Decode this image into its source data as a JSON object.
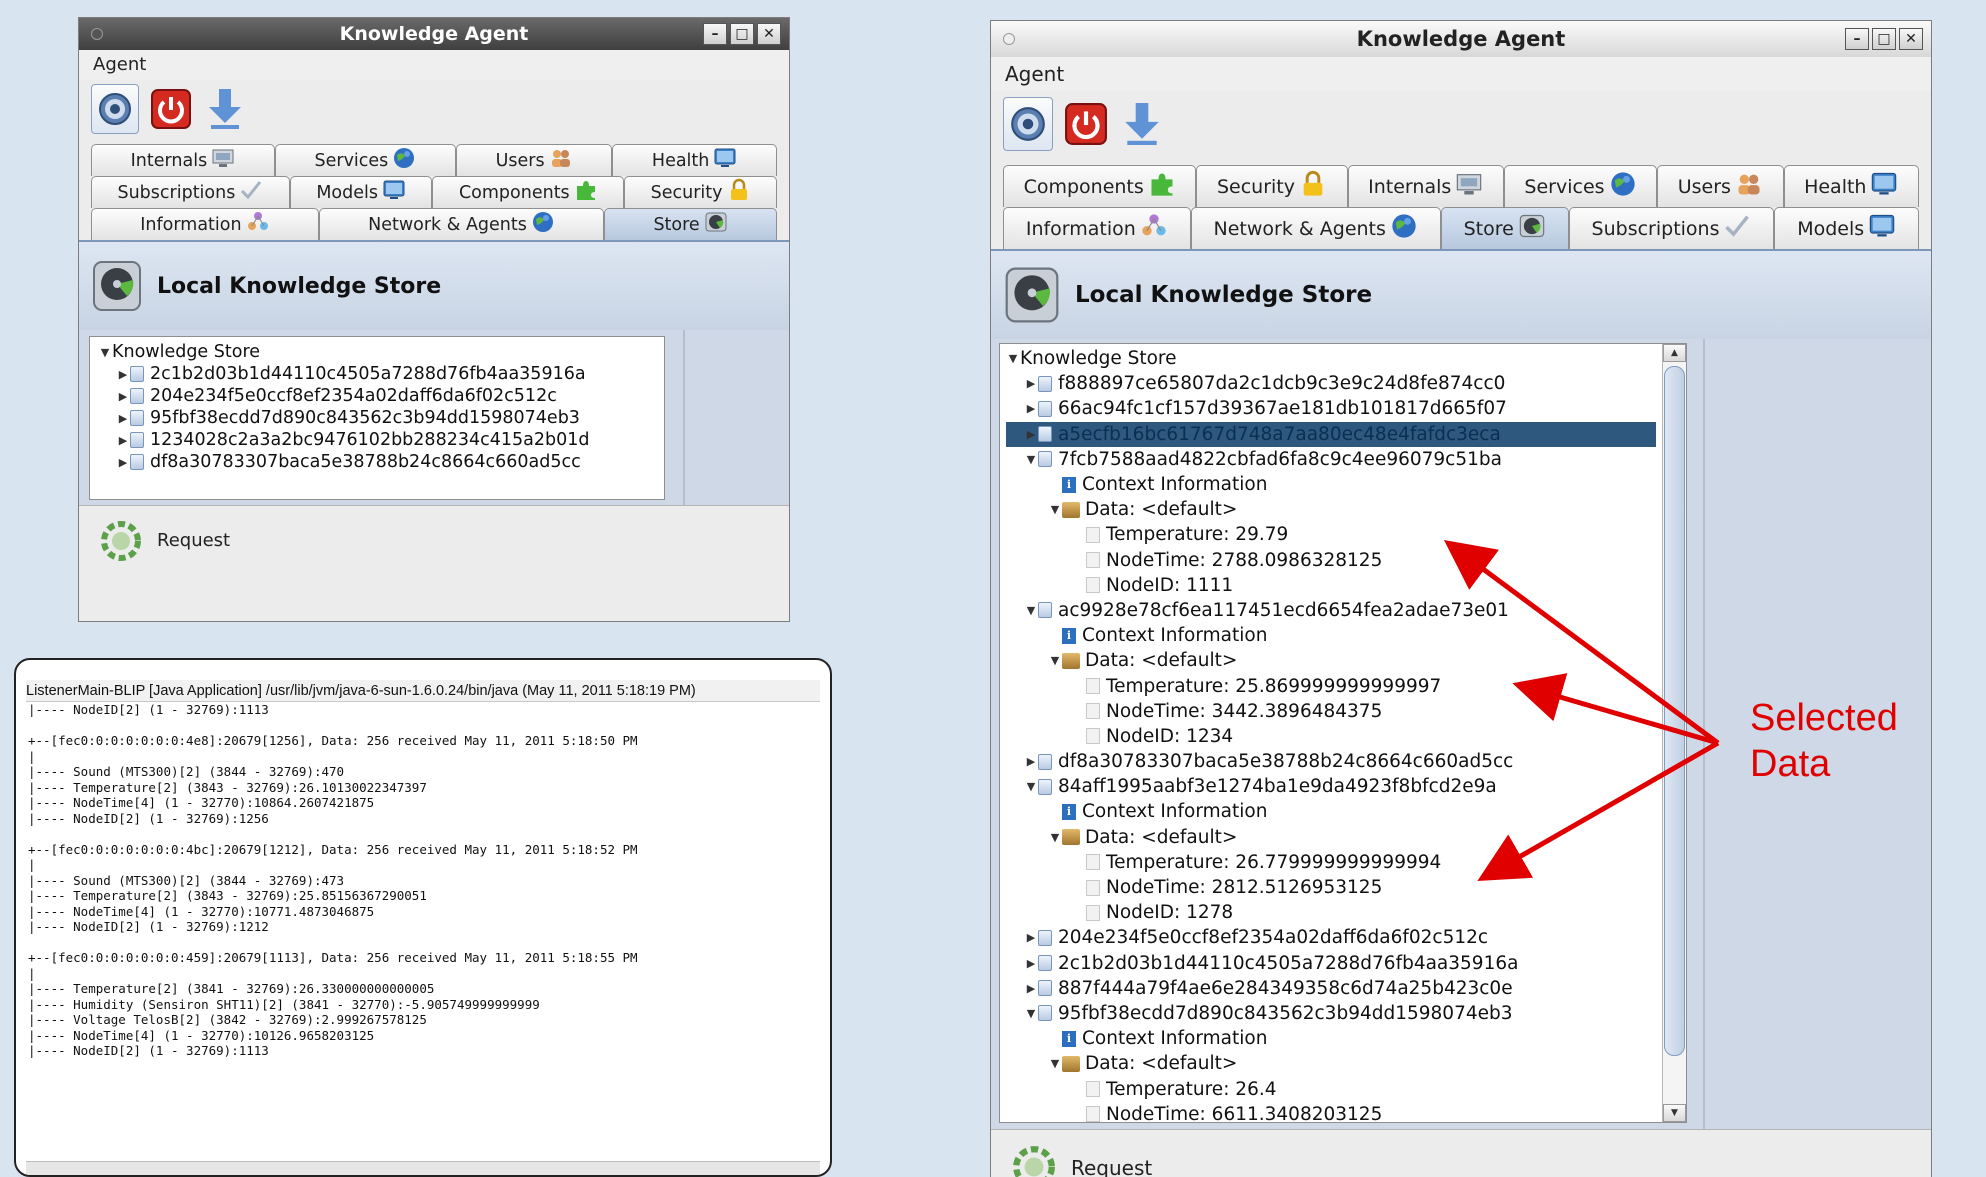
{
  "left_window": {
    "title": "Knowledge Agent",
    "menu": "Agent",
    "tab_rows": [
      [
        {
          "label": "Internals",
          "icon": "computer-icon"
        },
        {
          "label": "Services",
          "icon": "globe-icon"
        },
        {
          "label": "Users",
          "icon": "users-icon"
        },
        {
          "label": "Health",
          "icon": "monitor-icon"
        }
      ],
      [
        {
          "label": "Subscriptions",
          "icon": "check-icon"
        },
        {
          "label": "Models",
          "icon": "monitor-icon"
        },
        {
          "label": "Components",
          "icon": "puzzle-icon"
        },
        {
          "label": "Security",
          "icon": "lock-icon"
        }
      ],
      [
        {
          "label": "Information",
          "icon": "network-icon"
        },
        {
          "label": "Network & Agents",
          "icon": "globe-icon"
        },
        {
          "label": "Store",
          "icon": "disk-icon"
        }
      ]
    ],
    "panel_title": "Local Knowledge Store",
    "tree_root": "Knowledge Store",
    "tree_items": [
      "2c1b2d03b1d44110c4505a7288d76fb4aa35916a",
      "204e234f5e0ccf8ef2354a02daff6da6f02c512c",
      "95fbf38ecdd7d890c843562c3b94dd1598074eb3",
      "1234028c2a3a2bc9476102bb288234c415a2b01d",
      "df8a30783307baca5e38788b24c8664c660ad5cc"
    ],
    "status": "Request"
  },
  "right_window": {
    "title": "Knowledge Agent",
    "menu": "Agent",
    "tab_rows": [
      [
        {
          "label": "Components",
          "icon": "puzzle-icon"
        },
        {
          "label": "Security",
          "icon": "lock-icon"
        },
        {
          "label": "Internals",
          "icon": "computer-icon"
        },
        {
          "label": "Services",
          "icon": "globe-icon"
        },
        {
          "label": "Users",
          "icon": "users-icon"
        },
        {
          "label": "Health",
          "icon": "monitor-icon"
        }
      ],
      [
        {
          "label": "Information",
          "icon": "network-icon"
        },
        {
          "label": "Network & Agents",
          "icon": "globe-icon"
        },
        {
          "label": "Store",
          "icon": "disk-icon"
        },
        {
          "label": "Subscriptions",
          "icon": "check-icon"
        },
        {
          "label": "Models",
          "icon": "monitor-icon"
        }
      ]
    ],
    "panel_title": "Local Knowledge Store",
    "tree_root": "Knowledge Store",
    "tree": [
      {
        "level": 1,
        "kind": "doc",
        "state": "collapsed",
        "text": "f888897ce65807da2c1dcb9c3e9c24d8fe874cc0"
      },
      {
        "level": 1,
        "kind": "doc",
        "state": "collapsed",
        "text": "66ac94fc1cf157d39367ae181db101817d665f07"
      },
      {
        "level": 1,
        "kind": "doc",
        "state": "collapsed",
        "text": "a5ecfb16bc61767d748a7aa80ec48e4fafdc3eca",
        "selected": true
      },
      {
        "level": 1,
        "kind": "doc",
        "state": "expanded",
        "text": "7fcb7588aad4822cbfad6fa8c9c4ee96079c51ba"
      },
      {
        "level": 2,
        "kind": "info",
        "state": "leaf",
        "text": "Context Information"
      },
      {
        "level": 2,
        "kind": "box",
        "state": "expanded",
        "text": "Data: <default>"
      },
      {
        "level": 3,
        "kind": "leaf",
        "state": "leaf",
        "text": "Temperature: 29.79"
      },
      {
        "level": 3,
        "kind": "leaf",
        "state": "leaf",
        "text": "NodeTime: 2788.0986328125"
      },
      {
        "level": 3,
        "kind": "leaf",
        "state": "leaf",
        "text": "NodeID: 1111"
      },
      {
        "level": 1,
        "kind": "doc",
        "state": "expanded",
        "text": "ac9928e78cf6ea117451ecd6654fea2adae73e01"
      },
      {
        "level": 2,
        "kind": "info",
        "state": "leaf",
        "text": "Context Information"
      },
      {
        "level": 2,
        "kind": "box",
        "state": "expanded",
        "text": "Data: <default>"
      },
      {
        "level": 3,
        "kind": "leaf",
        "state": "leaf",
        "text": "Temperature: 25.869999999999997"
      },
      {
        "level": 3,
        "kind": "leaf",
        "state": "leaf",
        "text": "NodeTime: 3442.3896484375"
      },
      {
        "level": 3,
        "kind": "leaf",
        "state": "leaf",
        "text": "NodeID: 1234"
      },
      {
        "level": 1,
        "kind": "doc",
        "state": "collapsed",
        "text": "df8a30783307baca5e38788b24c8664c660ad5cc"
      },
      {
        "level": 1,
        "kind": "doc",
        "state": "expanded",
        "text": "84aff1995aabf3e1274ba1e9da4923f8bfcd2e9a"
      },
      {
        "level": 2,
        "kind": "info",
        "state": "leaf",
        "text": "Context Information"
      },
      {
        "level": 2,
        "kind": "box",
        "state": "expanded",
        "text": "Data: <default>"
      },
      {
        "level": 3,
        "kind": "leaf",
        "state": "leaf",
        "text": "Temperature: 26.779999999999994"
      },
      {
        "level": 3,
        "kind": "leaf",
        "state": "leaf",
        "text": "NodeTime: 2812.5126953125"
      },
      {
        "level": 3,
        "kind": "leaf",
        "state": "leaf",
        "text": "NodeID: 1278"
      },
      {
        "level": 1,
        "kind": "doc",
        "state": "collapsed",
        "text": "204e234f5e0ccf8ef2354a02daff6da6f02c512c"
      },
      {
        "level": 1,
        "kind": "doc",
        "state": "collapsed",
        "text": "2c1b2d03b1d44110c4505a7288d76fb4aa35916a"
      },
      {
        "level": 1,
        "kind": "doc",
        "state": "collapsed",
        "text": "887f444a79f4ae6e284349358c6d74a25b423c0e"
      },
      {
        "level": 1,
        "kind": "doc",
        "state": "expanded",
        "text": "95fbf38ecdd7d890c843562c3b94dd1598074eb3"
      },
      {
        "level": 2,
        "kind": "info",
        "state": "leaf",
        "text": "Context Information"
      },
      {
        "level": 2,
        "kind": "box",
        "state": "expanded",
        "text": "Data: <default>"
      },
      {
        "level": 3,
        "kind": "leaf",
        "state": "leaf",
        "text": "Temperature: 26.4"
      },
      {
        "level": 3,
        "kind": "leaf",
        "state": "leaf",
        "text": "NodeTime: 6611.3408203125"
      }
    ],
    "status": "Request"
  },
  "console": {
    "header": "ListenerMain-BLIP [Java Application] /usr/lib/jvm/java-6-sun-1.6.0.24/bin/java (May 11, 2011 5:18:19 PM)",
    "lines": [
      "|---- NodeID[2] (1 - 32769):1113",
      "",
      "+--[fec0:0:0:0:0:0:0:4e8]:20679[1256], Data: 256 received May 11, 2011 5:18:50 PM",
      "|",
      "|---- Sound (MTS300)[2] (3844 - 32769):470",
      "|---- Temperature[2] (3843 - 32769):26.10130022347397",
      "|---- NodeTime[4] (1 - 32770):10864.2607421875",
      "|---- NodeID[2] (1 - 32769):1256",
      "",
      "+--[fec0:0:0:0:0:0:0:4bc]:20679[1212], Data: 256 received May 11, 2011 5:18:52 PM",
      "|",
      "|---- Sound (MTS300)[2] (3844 - 32769):473",
      "|---- Temperature[2] (3843 - 32769):25.85156367290051",
      "|---- NodeTime[4] (1 - 32770):10771.4873046875",
      "|---- NodeID[2] (1 - 32769):1212",
      "",
      "+--[fec0:0:0:0:0:0:0:459]:20679[1113], Data: 256 received May 11, 2011 5:18:55 PM",
      "|",
      "|---- Temperature[2] (3841 - 32769):26.330000000000005",
      "|---- Humidity (Sensiron SHT11)[2] (3841 - 32770):-5.905749999999999",
      "|---- Voltage TelosB[2] (3842 - 32769):2.999267578125",
      "|---- NodeTime[4] (1 - 32770):10126.9658203125",
      "|---- NodeID[2] (1 - 32769):1113"
    ]
  },
  "annotation": {
    "line1": "Selected",
    "line2": "Data",
    "color": "#e00000"
  }
}
